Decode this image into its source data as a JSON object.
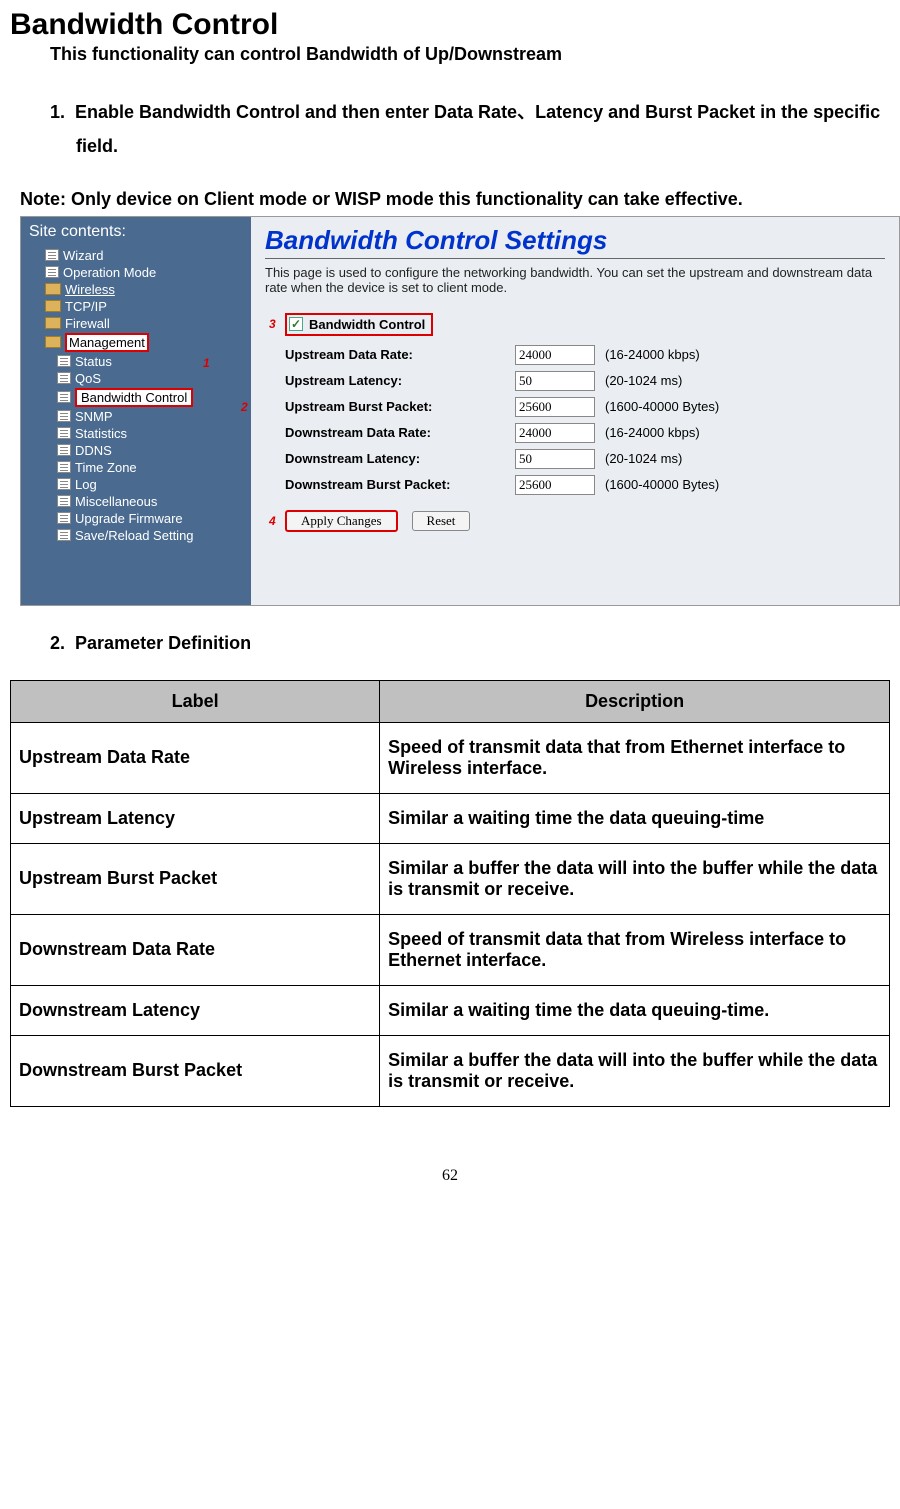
{
  "heading": "Bandwidth Control",
  "intro": "This functionality can control Bandwidth of Up/Downstream",
  "step1_num": "1.",
  "step1": "Enable Bandwidth Control and then enter Data Rate、Latency and Burst Packet in the specific field.",
  "note": "Note: Only device on Client mode or WISP mode this functionality can take effective.",
  "step2_num": "2.",
  "step2": "Parameter Definition",
  "page_number": "62",
  "sidebar": {
    "title": "Site contents:",
    "items": [
      "Wizard",
      "Operation Mode",
      "Wireless",
      "TCP/IP",
      "Firewall",
      "Management",
      "Status",
      "QoS",
      "Bandwidth Control",
      "SNMP",
      "Statistics",
      "DDNS",
      "Time Zone",
      "Log",
      "Miscellaneous",
      "Upgrade Firmware",
      "Save/Reload Setting"
    ]
  },
  "markers": {
    "one": "1",
    "two": "2",
    "three": "3",
    "four": "4"
  },
  "form": {
    "title": "Bandwidth Control Settings",
    "desc": "This page is used to configure the networking bandwidth. You can set the upstream and downstream data rate when the device is set to client mode.",
    "enable": "Bandwidth Control",
    "rows": [
      {
        "label": "Upstream Data Rate:",
        "value": "24000",
        "hint": "(16-24000 kbps)"
      },
      {
        "label": "Upstream Latency:",
        "value": "50",
        "hint": "(20-1024 ms)"
      },
      {
        "label": "Upstream Burst Packet:",
        "value": "25600",
        "hint": "(1600-40000 Bytes)"
      },
      {
        "label": "Downstream Data Rate:",
        "value": "24000",
        "hint": "(16-24000 kbps)"
      },
      {
        "label": "Downstream Latency:",
        "value": "50",
        "hint": "(20-1024 ms)"
      },
      {
        "label": "Downstream Burst Packet:",
        "value": "25600",
        "hint": "(1600-40000 Bytes)"
      }
    ],
    "apply": "Apply Changes",
    "reset": "Reset"
  },
  "table": {
    "head_label": "Label",
    "head_desc": "Description",
    "rows": [
      {
        "label": "Upstream Data Rate",
        "desc": "Speed of transmit data that from Ethernet interface to Wireless interface."
      },
      {
        "label": "Upstream Latency",
        "desc": "Similar a waiting time the data queuing-time"
      },
      {
        "label": "Upstream Burst Packet",
        "desc": "Similar a buffer the data will into the buffer while the data is transmit or receive."
      },
      {
        "label": "Downstream Data Rate",
        "desc": "Speed of transmit data that from Wireless interface to Ethernet interface."
      },
      {
        "label": "Downstream Latency",
        "desc": "Similar a waiting time the data queuing-time."
      },
      {
        "label": "Downstream Burst Packet",
        "desc": "Similar a buffer the data will into the buffer while the data is transmit or receive."
      }
    ]
  }
}
